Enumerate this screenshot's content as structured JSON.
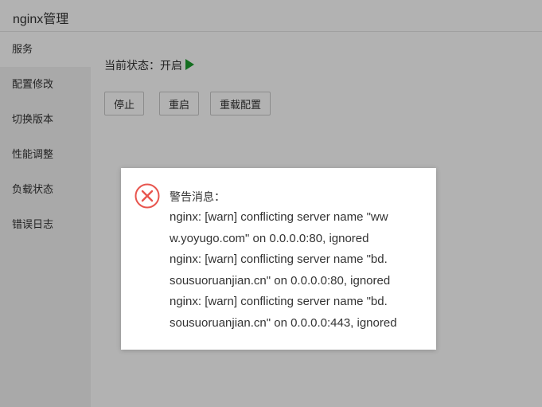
{
  "app": {
    "title": "nginx管理"
  },
  "sidebar": {
    "items": [
      {
        "label": "服务",
        "active": true
      },
      {
        "label": "配置修改"
      },
      {
        "label": "切换版本"
      },
      {
        "label": "性能调整"
      },
      {
        "label": "负载状态"
      },
      {
        "label": "错误日志"
      }
    ]
  },
  "main": {
    "status_text": "当前状态：开启",
    "status_icon": "play-icon",
    "status_color": "#1e9e2f",
    "buttons": {
      "stop": "停止",
      "restart": "重启",
      "reload": "重载配置"
    }
  },
  "dialog": {
    "icon": "error-circle-icon",
    "icon_color": "#e8554e",
    "title": "警告消息：",
    "lines": [
      "nginx: [warn] conflicting server name \"ww",
      "w.yoyugo.com\" on 0.0.0.0:80, ignored",
      "nginx: [warn] conflicting server name \"bd.",
      "sousuoruanjian.cn\" on 0.0.0.0:80, ignored",
      "nginx: [warn] conflicting server name \"bd.",
      "sousuoruanjian.cn\" on 0.0.0.0:443, ignored"
    ]
  }
}
